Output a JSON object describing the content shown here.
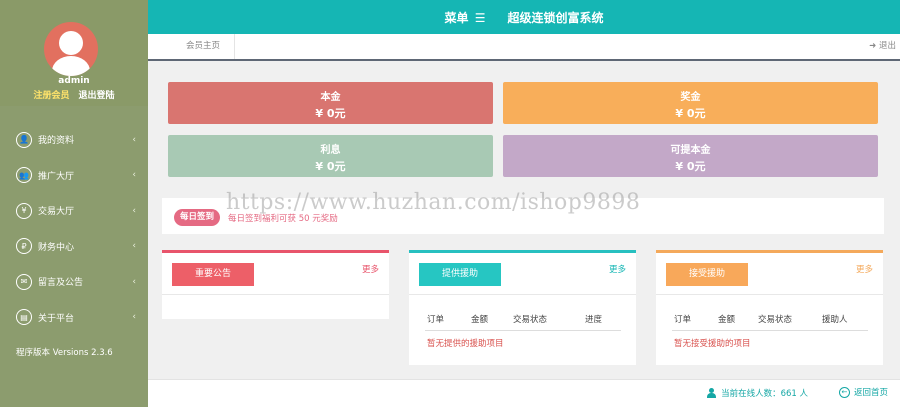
{
  "header": {
    "menu_label": "菜单",
    "menu_glyph": "☰",
    "site_title": "超级连锁创富系统"
  },
  "breadcrumb": {
    "home_tab": "会员主页",
    "logout": "退出"
  },
  "user": {
    "username": "admin",
    "register_link": "注册会员",
    "logout_link": "退出登陆"
  },
  "sidebar": {
    "items": [
      {
        "label": "我的资料",
        "icon": "user-icon",
        "glyph": "👤"
      },
      {
        "label": "推广大厅",
        "icon": "group-icon",
        "glyph": "👥"
      },
      {
        "label": "交易大厅",
        "icon": "yen-icon",
        "glyph": "¥"
      },
      {
        "label": "财务中心",
        "icon": "finance-icon",
        "glyph": "₽"
      },
      {
        "label": "留言及公告",
        "icon": "message-icon",
        "glyph": "✉"
      },
      {
        "label": "关于平台",
        "icon": "document-icon",
        "glyph": "▤"
      }
    ],
    "chevron": "‹",
    "version": "程序版本 Versions 2.3.6"
  },
  "stats": {
    "principal": {
      "title": "本金",
      "amount": "¥ 0元",
      "color": "#d97570"
    },
    "bonus": {
      "title": "奖金",
      "amount": "¥ 0元",
      "color": "#f8ae5a"
    },
    "interest": {
      "title": "利息",
      "amount": "¥ 0元",
      "color": "#a8c9b4"
    },
    "withdrawable": {
      "title": "可提本金",
      "amount": "¥ 0元",
      "color": "#c3a8c8"
    }
  },
  "signin": {
    "button": "每日签到",
    "text": "每日签到福利可获 50 元奖励"
  },
  "watermark": "https://www.huzhan.com/ishop9898",
  "panels": {
    "notice": {
      "title": "重要公告",
      "more": "更多"
    },
    "provide": {
      "title": "提供援助",
      "more": "更多",
      "columns": [
        "订单",
        "金额",
        "交易状态",
        "进度"
      ],
      "empty": "暂无提供的援助项目"
    },
    "accept": {
      "title": "接受援助",
      "more": "更多",
      "columns": [
        "订单",
        "金额",
        "交易状态",
        "援助人"
      ],
      "empty": "暂无接受援助的项目"
    }
  },
  "footer": {
    "online": "当前在线人数：661 人",
    "back_home": "返回首页"
  }
}
